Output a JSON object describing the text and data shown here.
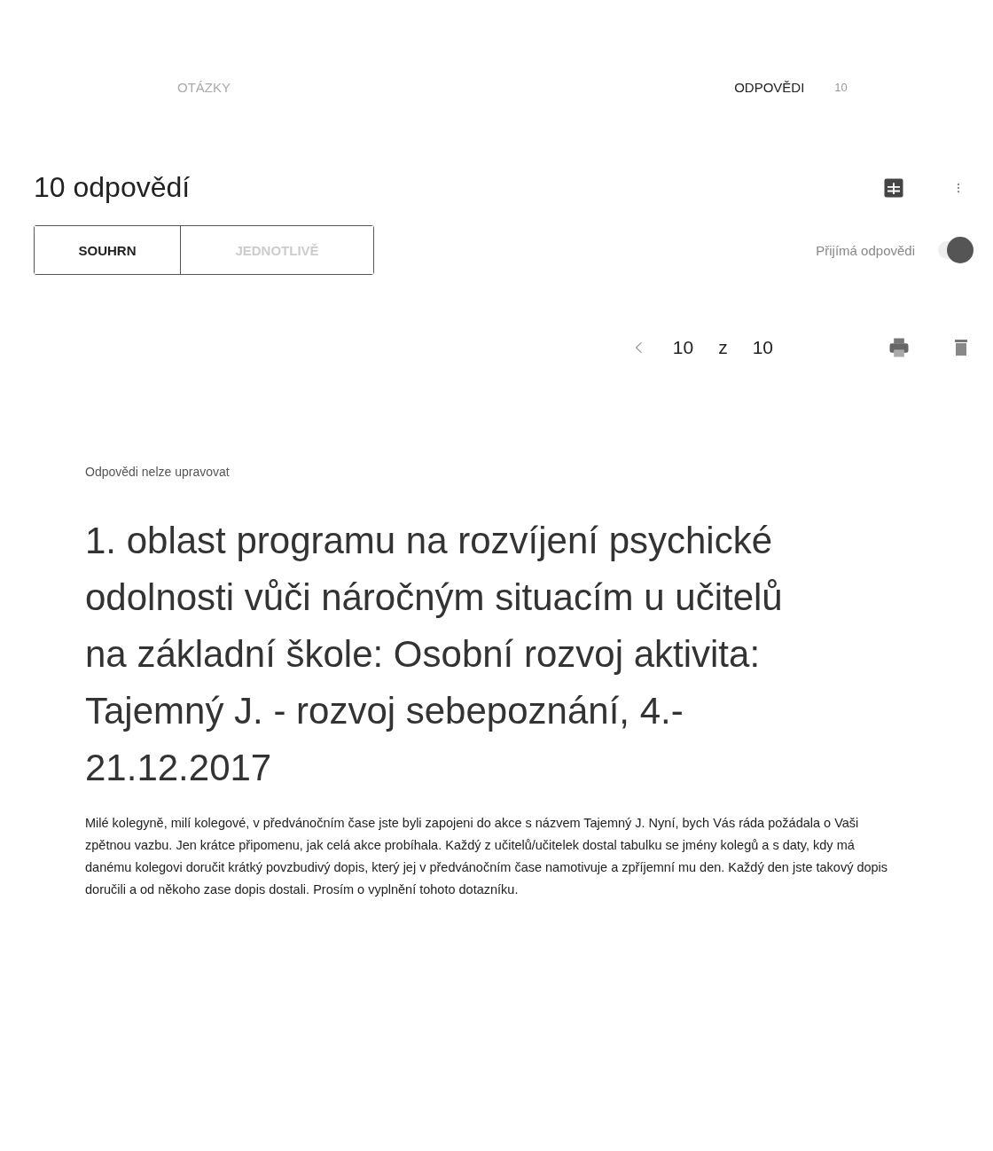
{
  "tabs": [
    {
      "label": "OTÁZKY",
      "selected": false
    },
    {
      "label": "ODPOVĚDI",
      "selected": true,
      "badge": "10"
    }
  ],
  "summary": {
    "title": "10 odpovědí"
  },
  "view_switch": [
    {
      "label": "SOUHRN",
      "selected": true
    },
    {
      "label": "JEDNOTLIVĚ",
      "selected": false
    }
  ],
  "accepting": {
    "label": "Přijímá odpovědi",
    "on": true
  },
  "pager": {
    "current": "10",
    "separator": "z",
    "total": "10"
  },
  "response": {
    "notice": "Odpovědi nelze upravovat",
    "title": "1. oblast programu na rozvíjení psychické odolnosti vůči náročným situacím u učitelů na základní škole: Osobní rozvoj aktivita: Tajemný J. - rozvoj sebepoznání, 4.- 21.12.2017",
    "description": "Milé kolegyně, milí kolegové, v předvánočním čase jste byli zapojeni do akce s názvem Tajemný J. Nyní, bych Vás ráda požádala o Vaši zpětnou vazbu. Jen krátce připomenu, jak celá akce probíhala. Každý z učitelů/učitelek dostal tabulku se jmény kolegů a s daty, kdy má danému kolegovi doručit krátký povzbudivý dopis, který jej v předvánočním čase namotivuje a zpříjemní mu den. Každý den jste takový dopis doručili a od někoho zase dopis dostali. Prosím o vyplnění tohoto dotazníku."
  }
}
